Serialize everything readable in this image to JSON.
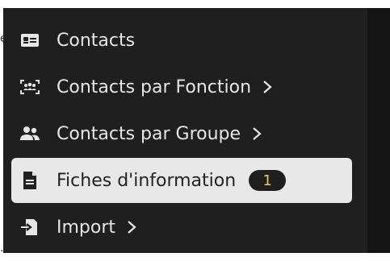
{
  "fragments": {
    "left_edge_char": "e",
    "bottom_edge_char": "."
  },
  "menu": {
    "items": [
      {
        "label": "Contacts",
        "icon": "id-card-icon",
        "submenu": false,
        "active": false
      },
      {
        "label": "Contacts par Fonction",
        "icon": "group-frame-icon",
        "submenu": true,
        "active": false
      },
      {
        "label": "Contacts par Groupe",
        "icon": "users-icon",
        "submenu": true,
        "active": false
      },
      {
        "label": "Fiches d'information",
        "icon": "document-icon",
        "submenu": false,
        "active": true,
        "badge": "1"
      },
      {
        "label": "Import",
        "icon": "file-import-icon",
        "submenu": true,
        "active": false
      }
    ]
  },
  "colors": {
    "menu_bg": "#1f1f1f",
    "active_bg": "#e8e8e8",
    "badge_text": "#f2c94c"
  }
}
